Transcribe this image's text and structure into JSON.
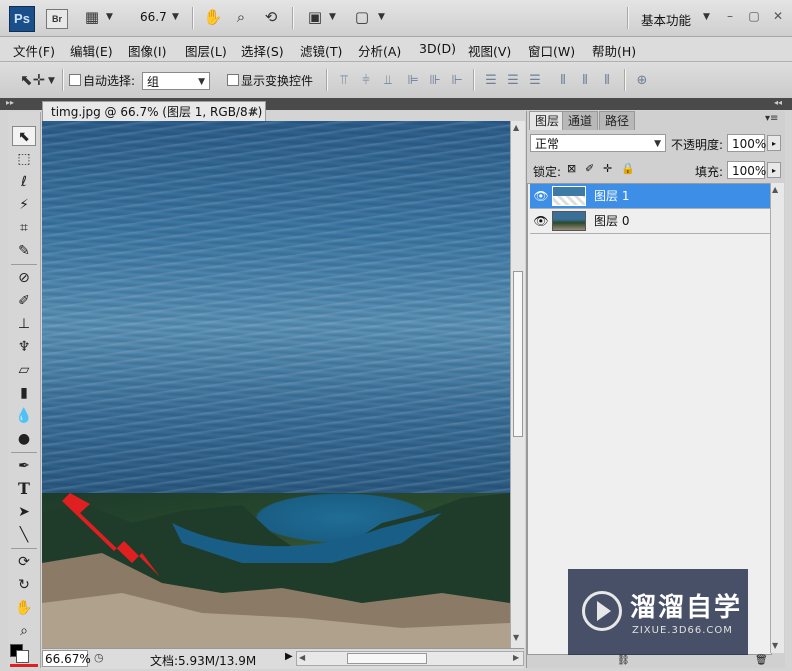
{
  "appbar": {
    "ps_logo": "Ps",
    "br_logo": "Br",
    "zoom_value": "66.7",
    "workspace": "基本功能"
  },
  "menu": [
    "文件(F)",
    "编辑(E)",
    "图像(I)",
    "图层(L)",
    "选择(S)",
    "滤镜(T)",
    "分析(A)",
    "3D(D)",
    "视图(V)",
    "窗口(W)",
    "帮助(H)"
  ],
  "options": {
    "auto_select_label": "自动选择:",
    "auto_select_value": "组",
    "show_transform_label": "显示变换控件"
  },
  "document": {
    "tab_title": "timg.jpg @ 66.7% (图层 1, RGB/8#) *",
    "zoom": "66.67%",
    "doc_size": "文档:5.93M/13.9M"
  },
  "layers_panel": {
    "tabs": [
      "图层",
      "通道",
      "路径"
    ],
    "blend_mode": "正常",
    "opacity_label": "不透明度:",
    "opacity_value": "100%",
    "lock_label": "锁定:",
    "fill_label": "填充:",
    "fill_value": "100%",
    "layers": [
      {
        "name": "图层 1",
        "selected": true
      },
      {
        "name": "图层 0",
        "selected": false
      }
    ]
  },
  "watermark": {
    "title": "溜溜自学",
    "url": "ZIXUE.3D66.COM"
  },
  "colors": {
    "selection_blue": "#3d8ee6",
    "arrow_red": "#e02020"
  }
}
